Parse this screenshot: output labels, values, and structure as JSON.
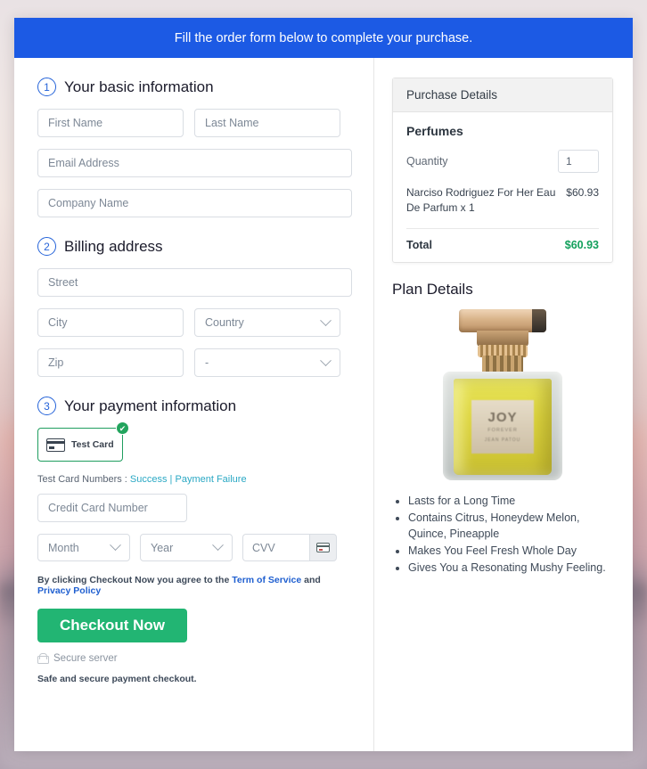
{
  "banner": {
    "text": "Fill the order form below to complete your purchase."
  },
  "sections": {
    "basic": {
      "step": "1",
      "title": "Your basic information",
      "fields": {
        "first_name": "First Name",
        "last_name": "Last Name",
        "email": "Email Address",
        "company": "Company Name"
      }
    },
    "billing": {
      "step": "2",
      "title": "Billing address",
      "fields": {
        "street": "Street",
        "city": "City",
        "country": "Country",
        "zip": "Zip",
        "state": "-"
      }
    },
    "payment": {
      "step": "3",
      "title": "Your payment information",
      "method_label": "Test Card",
      "check_mark": "✔",
      "testcard_prefix": "Test Card Numbers : ",
      "testcard_success": "Success",
      "testcard_separator": " | ",
      "testcard_failure": "Payment Failure",
      "fields": {
        "credit_card_number": "Credit Card Number",
        "month": "Month",
        "year": "Year",
        "cvv": "CVV"
      },
      "terms_prefix": "By clicking Checkout Now you agree to the ",
      "terms_link1": "Term of Service",
      "terms_middle": " and ",
      "terms_link2": "Privacy Policy",
      "checkout_label": "Checkout Now",
      "secure_server": "Secure server",
      "safe_note": "Safe and secure payment checkout."
    }
  },
  "purchase": {
    "header": "Purchase Details",
    "category": "Perfumes",
    "quantity_label": "Quantity",
    "quantity_value": "1",
    "item_name": "Narciso Rodriguez For Her Eau De Parfum x 1",
    "item_price": "$60.93",
    "total_label": "Total",
    "total_amount": "$60.93"
  },
  "plan": {
    "title": "Plan Details",
    "product_image": {
      "brand": "JOY",
      "line1": "FOREVER",
      "line2": "JEAN PATOU"
    },
    "features": [
      "Lasts for a Long Time",
      "Contains Citrus, Honeydew Melon, Quince, Pineapple",
      "Makes You Feel Fresh Whole Day",
      "Gives You a Resonating Mushy Feeling."
    ]
  },
  "colors": {
    "banner_blue": "#1c5ae4",
    "accent_green": "#22b573",
    "total_green": "#13a05c",
    "link_teal": "#2aa8c4",
    "link_blue": "#1f5fd0",
    "step_blue": "#2563d9"
  }
}
